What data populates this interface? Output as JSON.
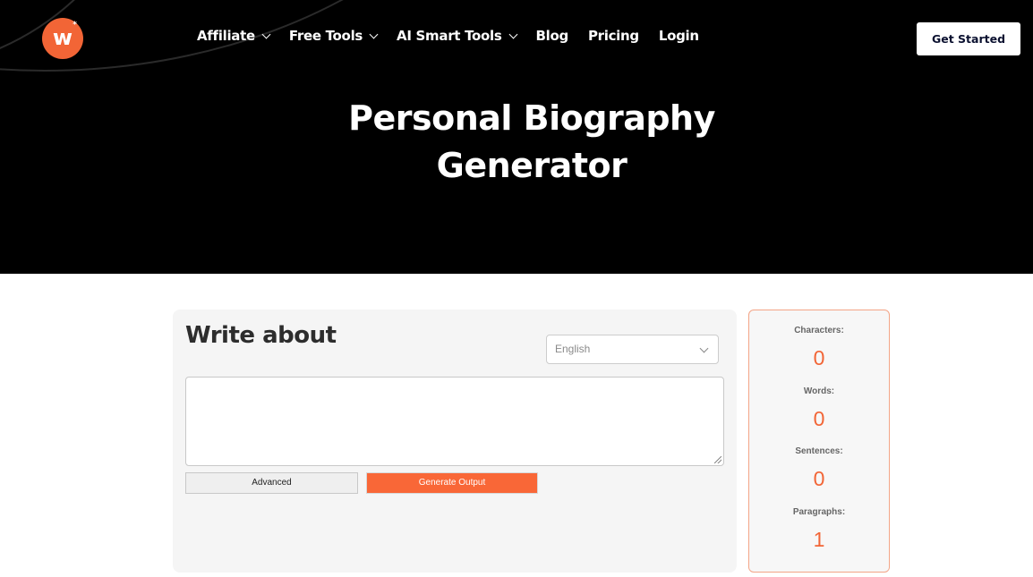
{
  "header": {
    "logo_letter": "w",
    "logo_star": "*",
    "nav": [
      {
        "label": "Affiliate",
        "dropdown": true
      },
      {
        "label": "Free Tools",
        "dropdown": true
      },
      {
        "label": "AI Smart Tools",
        "dropdown": true
      },
      {
        "label": "Blog",
        "dropdown": false
      },
      {
        "label": "Pricing",
        "dropdown": false
      },
      {
        "label": "Login",
        "dropdown": false
      }
    ],
    "cta_label": "Get Started"
  },
  "hero": {
    "title_line1": "Personal Biography",
    "title_line2": "Generator"
  },
  "form": {
    "title": "Write about",
    "language_selected": "English",
    "textarea_value": "",
    "advanced_label": "Advanced",
    "generate_label": "Generate Output"
  },
  "stats": [
    {
      "label": "Characters:",
      "value": "0"
    },
    {
      "label": "Words:",
      "value": "0"
    },
    {
      "label": "Sentences:",
      "value": "0"
    },
    {
      "label": "Paragraphs:",
      "value": "1"
    }
  ],
  "colors": {
    "accent": "#f26536",
    "hero_bg": "#000000",
    "card_bg": "#f5f5f5"
  }
}
